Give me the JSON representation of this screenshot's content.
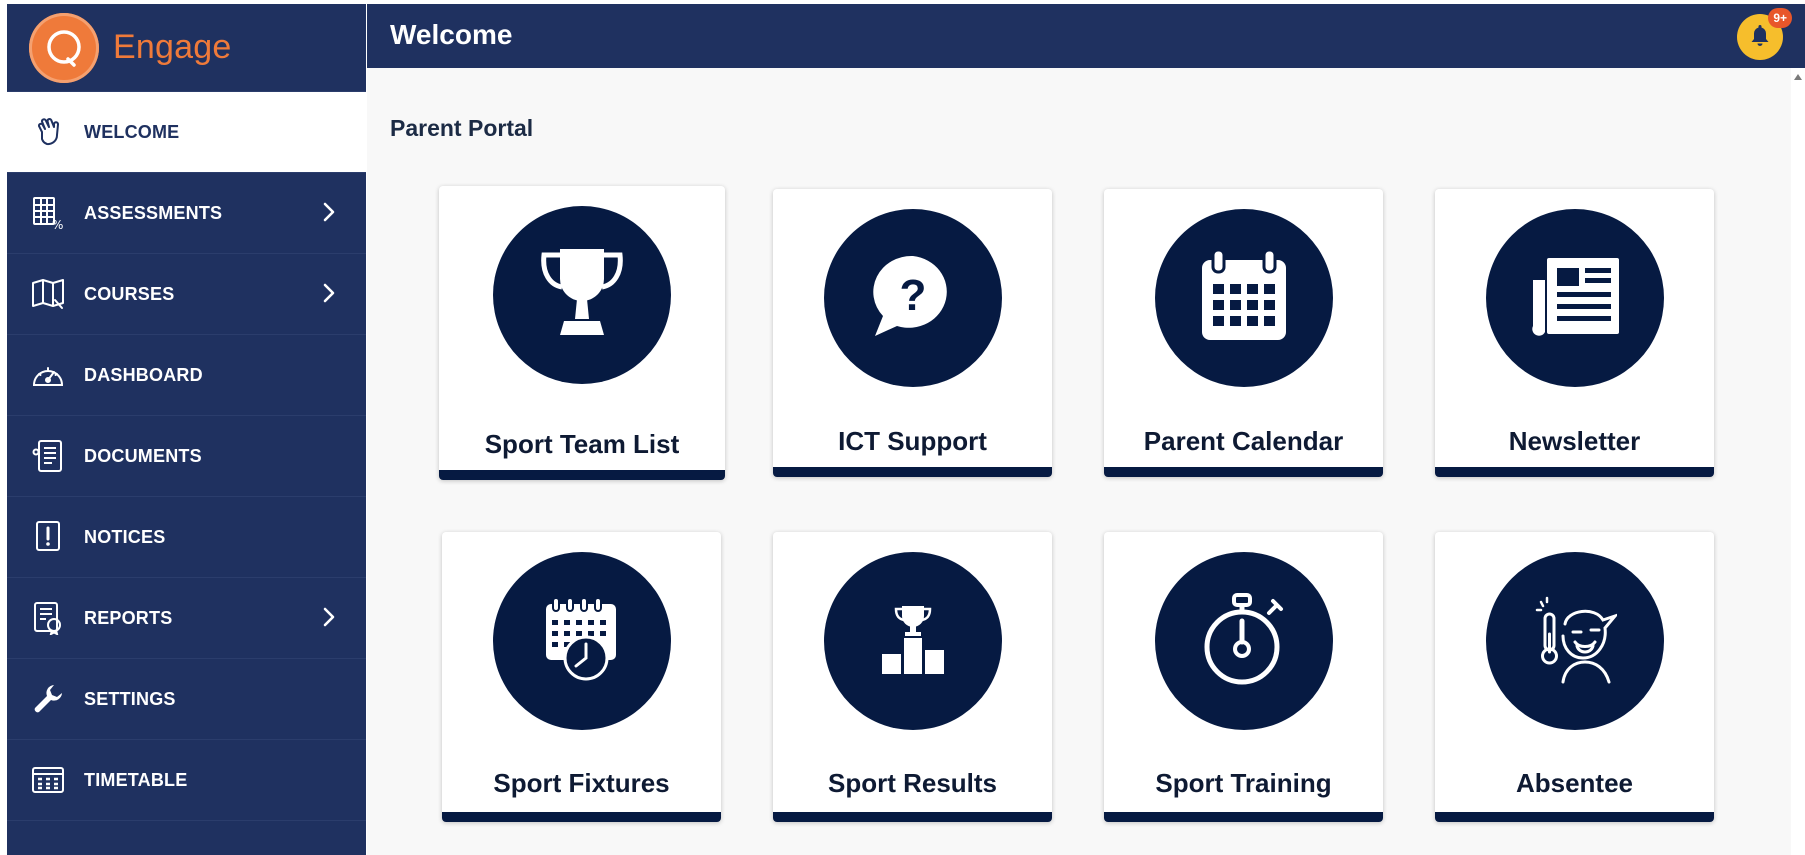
{
  "brand": {
    "name": "Engage",
    "accent": "#ef7a3a"
  },
  "colors": {
    "navy": "#1f3160",
    "tile_circle": "#061a42",
    "bell": "#f6be2c",
    "badge": "#e8562a"
  },
  "header": {
    "title": "Welcome",
    "notification_badge": "9+"
  },
  "sidebar": {
    "items": [
      {
        "label": "WELCOME",
        "icon": "waving-hand-icon",
        "active": true,
        "has_submenu": false
      },
      {
        "label": "ASSESSMENTS",
        "icon": "assessment-grid-icon",
        "active": false,
        "has_submenu": true
      },
      {
        "label": "COURSES",
        "icon": "book-icon",
        "active": false,
        "has_submenu": true
      },
      {
        "label": "DASHBOARD",
        "icon": "speedometer-icon",
        "active": false,
        "has_submenu": false
      },
      {
        "label": "DOCUMENTS",
        "icon": "document-icon",
        "active": false,
        "has_submenu": false
      },
      {
        "label": "NOTICES",
        "icon": "notice-icon",
        "active": false,
        "has_submenu": false
      },
      {
        "label": "REPORTS",
        "icon": "report-icon",
        "active": false,
        "has_submenu": true
      },
      {
        "label": "SETTINGS",
        "icon": "wrench-icon",
        "active": false,
        "has_submenu": false
      },
      {
        "label": "TIMETABLE",
        "icon": "timetable-icon",
        "active": false,
        "has_submenu": false
      }
    ]
  },
  "main": {
    "section_title": "Parent Portal",
    "tiles": [
      {
        "label": "Sport Team List",
        "icon": "trophy-icon"
      },
      {
        "label": "ICT Support",
        "icon": "question-bubble-icon"
      },
      {
        "label": "Parent Calendar",
        "icon": "calendar-icon"
      },
      {
        "label": "Newsletter",
        "icon": "newspaper-icon"
      },
      {
        "label": "Sport Fixtures",
        "icon": "calendar-clock-icon"
      },
      {
        "label": "Sport Results",
        "icon": "podium-icon"
      },
      {
        "label": "Sport Training",
        "icon": "stopwatch-icon"
      },
      {
        "label": "Absentee",
        "icon": "sick-person-icon"
      }
    ]
  }
}
